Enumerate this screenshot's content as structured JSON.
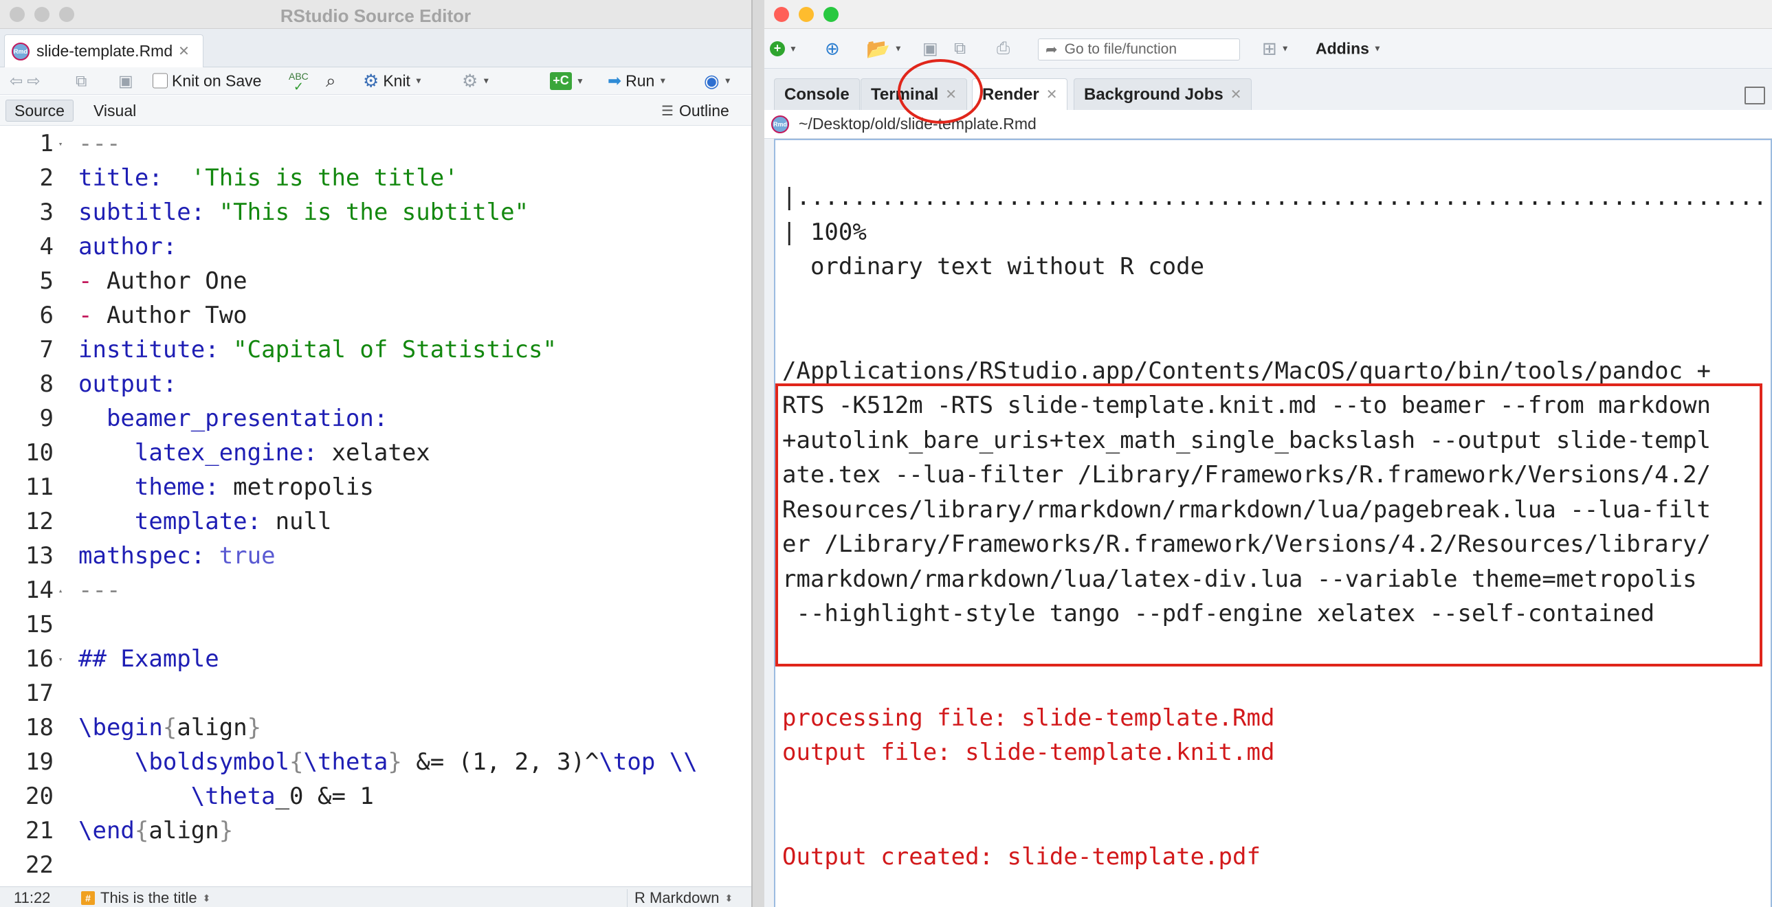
{
  "source_window": {
    "title": "RStudio Source Editor",
    "file_tab": "slide-template.Rmd",
    "toolbar": {
      "knit_on_save": "Knit on Save",
      "knit": "Knit",
      "run": "Run",
      "abc": "ABC"
    },
    "modes": {
      "source": "Source",
      "visual": "Visual",
      "outline": "Outline"
    },
    "code_lines": [
      {
        "n": "1",
        "parts": [
          {
            "t": "---",
            "c": "sep"
          }
        ]
      },
      {
        "n": "2",
        "parts": [
          {
            "t": "title:",
            "c": "kw"
          },
          {
            "t": "  'This is the title'",
            "c": "str"
          }
        ]
      },
      {
        "n": "3",
        "parts": [
          {
            "t": "subtitle:",
            "c": "kw"
          },
          {
            "t": " \"This is the subtitle\"",
            "c": "str"
          }
        ]
      },
      {
        "n": "4",
        "parts": [
          {
            "t": "author:",
            "c": "kw"
          }
        ]
      },
      {
        "n": "5",
        "parts": [
          {
            "t": "-",
            "c": "dash"
          },
          {
            "t": " Author One",
            "c": ""
          }
        ]
      },
      {
        "n": "6",
        "parts": [
          {
            "t": "-",
            "c": "dash"
          },
          {
            "t": " Author Two",
            "c": ""
          }
        ]
      },
      {
        "n": "7",
        "parts": [
          {
            "t": "institute:",
            "c": "kw"
          },
          {
            "t": " \"Capital of Statistics\"",
            "c": "str"
          }
        ]
      },
      {
        "n": "8",
        "parts": [
          {
            "t": "output:",
            "c": "kw"
          }
        ]
      },
      {
        "n": "9",
        "parts": [
          {
            "t": "  beamer_presentation:",
            "c": "kw"
          }
        ]
      },
      {
        "n": "10",
        "parts": [
          {
            "t": "    latex_engine:",
            "c": "kw"
          },
          {
            "t": " xelatex",
            "c": ""
          }
        ]
      },
      {
        "n": "11",
        "parts": [
          {
            "t": "    theme:",
            "c": "kw"
          },
          {
            "t": " metropolis",
            "c": ""
          }
        ]
      },
      {
        "n": "12",
        "parts": [
          {
            "t": "    template:",
            "c": "kw"
          },
          {
            "t": " null",
            "c": ""
          }
        ]
      },
      {
        "n": "13",
        "parts": [
          {
            "t": "mathspec:",
            "c": "kw"
          },
          {
            "t": " true",
            "c": "const"
          }
        ]
      },
      {
        "n": "14",
        "parts": [
          {
            "t": "---",
            "c": "sep"
          }
        ]
      },
      {
        "n": "15",
        "parts": []
      },
      {
        "n": "16",
        "parts": [
          {
            "t": "## Example",
            "c": "hdr"
          }
        ]
      },
      {
        "n": "17",
        "parts": []
      },
      {
        "n": "18",
        "parts": [
          {
            "t": "\\begin",
            "c": "kw"
          },
          {
            "t": "{",
            "c": "sep"
          },
          {
            "t": "align",
            "c": ""
          },
          {
            "t": "}",
            "c": "sep"
          }
        ]
      },
      {
        "n": "19",
        "parts": [
          {
            "t": "    \\boldsymbol",
            "c": "kw"
          },
          {
            "t": "{",
            "c": "sep"
          },
          {
            "t": "\\theta",
            "c": "kw"
          },
          {
            "t": "}",
            "c": "sep"
          },
          {
            "t": " &= (1, 2, 3)^",
            "c": ""
          },
          {
            "t": "\\top",
            "c": "kw"
          },
          {
            "t": " ",
            "c": ""
          },
          {
            "t": "\\\\",
            "c": "kw"
          }
        ]
      },
      {
        "n": "20",
        "parts": [
          {
            "t": "        \\theta",
            "c": "kw"
          },
          {
            "t": "_0 &= 1",
            "c": ""
          }
        ]
      },
      {
        "n": "21",
        "parts": [
          {
            "t": "\\end",
            "c": "kw"
          },
          {
            "t": "{",
            "c": "sep"
          },
          {
            "t": "align",
            "c": ""
          },
          {
            "t": "}",
            "c": "sep"
          }
        ]
      },
      {
        "n": "22",
        "parts": []
      }
    ],
    "status": {
      "position": "11:22",
      "section": "This is the title",
      "filetype": "R Markdown"
    }
  },
  "main_window": {
    "toolbar": {
      "goto_placeholder": "Go to file/function",
      "addins": "Addins"
    },
    "tabs": [
      {
        "label": "Console",
        "closable": false
      },
      {
        "label": "Terminal",
        "closable": true
      },
      {
        "label": "Render",
        "closable": true
      },
      {
        "label": "Background Jobs",
        "closable": true
      }
    ],
    "path": "~/Desktop/old/slide-template.Rmd",
    "console_lines": [
      {
        "t": "|..........................................................................",
        "c": ""
      },
      {
        "t": "| 100%",
        "c": ""
      },
      {
        "t": "  ordinary text without R code",
        "c": ""
      },
      {
        "t": "",
        "c": ""
      },
      {
        "t": "",
        "c": ""
      },
      {
        "t": "/Applications/RStudio.app/Contents/MacOS/quarto/bin/tools/pandoc +",
        "c": ""
      },
      {
        "t": "RTS -K512m -RTS slide-template.knit.md --to beamer --from markdown",
        "c": ""
      },
      {
        "t": "+autolink_bare_uris+tex_math_single_backslash --output slide-templ",
        "c": ""
      },
      {
        "t": "ate.tex --lua-filter /Library/Frameworks/R.framework/Versions/4.2/",
        "c": ""
      },
      {
        "t": "Resources/library/rmarkdown/rmarkdown/lua/pagebreak.lua --lua-filt",
        "c": ""
      },
      {
        "t": "er /Library/Frameworks/R.framework/Versions/4.2/Resources/library/",
        "c": ""
      },
      {
        "t": "rmarkdown/rmarkdown/lua/latex-div.lua --variable theme=metropolis",
        "c": ""
      },
      {
        "t": " --highlight-style tango --pdf-engine xelatex --self-contained",
        "c": ""
      },
      {
        "t": "",
        "c": ""
      },
      {
        "t": "",
        "c": ""
      },
      {
        "t": "processing file: slide-template.Rmd",
        "c": "redtext"
      },
      {
        "t": "output file: slide-template.knit.md",
        "c": "redtext"
      },
      {
        "t": "",
        "c": ""
      },
      {
        "t": "",
        "c": ""
      },
      {
        "t": "Output created: slide-template.pdf",
        "c": "redtext"
      }
    ]
  }
}
